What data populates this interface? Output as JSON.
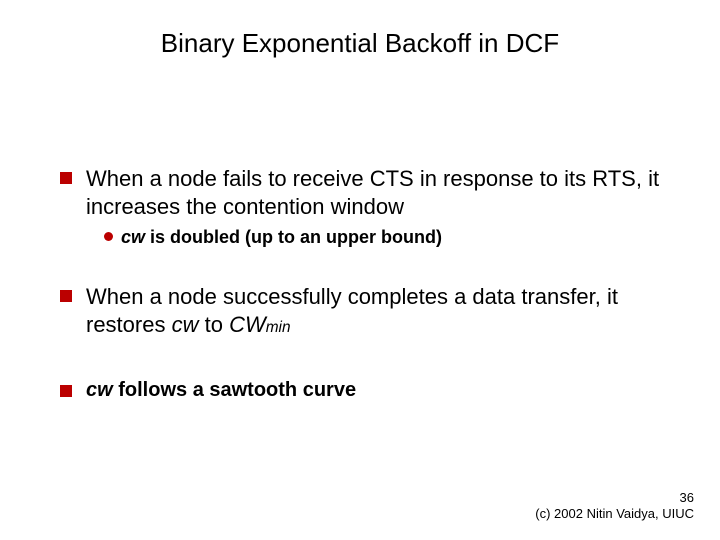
{
  "title": "Binary Exponential Backoff in DCF",
  "bullets": {
    "b1": {
      "line": "When a node fails to receive CTS in response to its RTS, it increases the contention window",
      "sub": {
        "prefix": "cw",
        "rest": " is doubled (up to an upper bound)"
      }
    },
    "b2": {
      "pre": "When a node successfully completes a data transfer, it restores ",
      "cw": "cw",
      "mid": " to ",
      "cwmin_base": "CW",
      "cwmin_sub": "min"
    },
    "b3": {
      "cw": "cw",
      "rest": " follows a sawtooth curve"
    }
  },
  "footer": {
    "page": "36",
    "copyright": "(c) 2002 Nitin Vaidya, UIUC"
  }
}
